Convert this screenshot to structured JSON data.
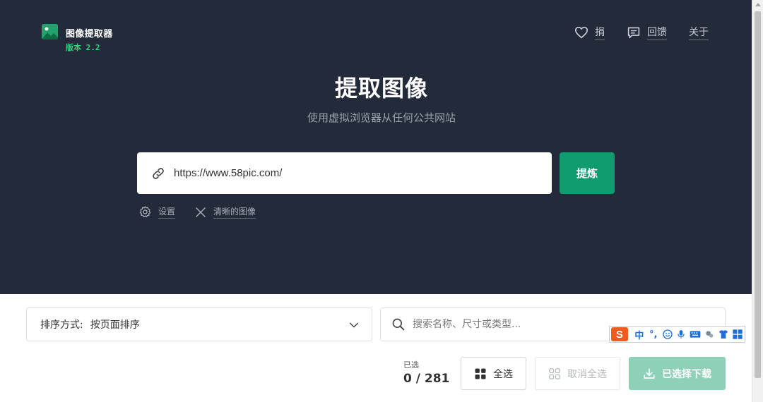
{
  "app": {
    "title": "图像提取器",
    "version": "版本 2.2"
  },
  "nav": {
    "donate": "捐",
    "feedback": "回馈",
    "about": "关于"
  },
  "hero": {
    "title": "提取图像",
    "subtitle": "使用虚拟浏览器从任何公共网站"
  },
  "url_input": {
    "value": "https://www.58pic.com/"
  },
  "extract_button": "提炼",
  "options": {
    "settings": "设置",
    "clear": "清晰的图像"
  },
  "toolbar": {
    "sort_key": "排序方式:",
    "sort_value": "按页面排序",
    "search_placeholder": "搜索名称、尺寸或类型...",
    "selected_label": "已选",
    "selected_count": "0 / 281",
    "select_all": "全选",
    "deselect_all": "取消全选",
    "download_selected": "已选择下载"
  },
  "ime": {
    "logo": "S",
    "mode": "中"
  },
  "colors": {
    "hero_bg": "#232b3b",
    "accent": "#109b70",
    "accent_disabled": "#8fd0b8",
    "version_green": "#2fd37a"
  }
}
